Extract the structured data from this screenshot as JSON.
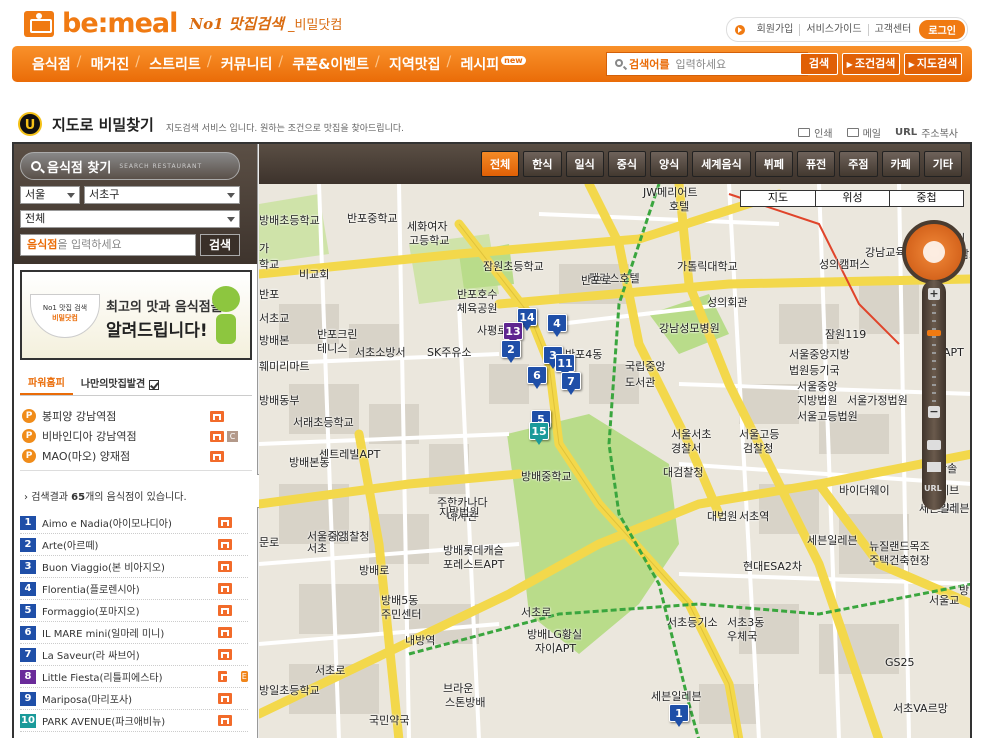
{
  "header": {
    "logo_text": "be:meal",
    "slogan": "No1 맛집검색",
    "slogan_sub": "_비밀닷컴",
    "top_links": [
      "회원가입",
      "서비스가이드",
      "고객센터"
    ],
    "login_label": "로그인"
  },
  "gnb": {
    "items": [
      "음식점",
      "매거진",
      "스트리트",
      "커뮤니티",
      "쿠폰&이벤트",
      "지역맛집",
      "레시피"
    ],
    "new_badge": "new",
    "search_keyword": "검색어를",
    "search_placeholder": "입력하세요",
    "search_button": "검색",
    "cond_button": "조건검색",
    "map_button": "지도검색"
  },
  "page": {
    "badge": "U",
    "title": "지도로 비밀찾기",
    "desc": "지도검색 서비스 입니다. 원하는 조건으로 맛집을 찾아드립니다.",
    "utils": [
      "인쇄",
      "메일",
      "주소복사"
    ],
    "url_tag": "URL"
  },
  "left_panel": {
    "finder_title": "음식점 찾기",
    "finder_en": "SEARCH RESTAURANT",
    "city": "서울",
    "district": "서초구",
    "category": "전체",
    "keyword_highlight": "음식점",
    "keyword_placeholder": "을 입력하세요",
    "search_button": "검색",
    "banner": {
      "bowl_line1": "No1 맛집 검색",
      "bowl_line2": "비밀닷컴",
      "line1": "최고의 맛과 음식점을",
      "line2": "알려드립니다!"
    },
    "tabs": [
      "파워홈피",
      "나만의맛집발견"
    ],
    "power": [
      {
        "name": "봉피양 강남역점",
        "coupon": false
      },
      {
        "name": "비바인디아 강남역점",
        "coupon": true
      },
      {
        "name": "MAO(마오) 양재점",
        "coupon": false
      }
    ],
    "power_icon": "P",
    "coupon_label": "C",
    "event_label": "E",
    "result_prefix": "검색결과 ",
    "result_count": "65",
    "result_suffix": "개의 음식점이 있습니다.",
    "results": [
      {
        "num": "1",
        "name": "Aimo e Nadia(아이모나디아)",
        "color": "blue",
        "event": false
      },
      {
        "num": "2",
        "name": "Arte(아르떼)",
        "color": "blue",
        "event": false
      },
      {
        "num": "3",
        "name": "Buon Viaggio(본 비아지오)",
        "color": "blue",
        "event": false
      },
      {
        "num": "4",
        "name": "Florentia(플로렌시아)",
        "color": "blue",
        "event": false
      },
      {
        "num": "5",
        "name": "Formaggio(포마지오)",
        "color": "blue",
        "event": false
      },
      {
        "num": "6",
        "name": "IL MARE mini(일마레 미니)",
        "color": "blue",
        "event": false
      },
      {
        "num": "7",
        "name": "La Saveur(라 싸브어)",
        "color": "blue",
        "event": false
      },
      {
        "num": "8",
        "name": "Little Fiesta(리틀피에스타)",
        "color": "purple",
        "event": true
      },
      {
        "num": "9",
        "name": "Mariposa(마리포사)",
        "color": "blue",
        "event": false
      },
      {
        "num": "10",
        "name": "PARK AVENUE(파크애비뉴)",
        "color": "teal",
        "event": false
      }
    ]
  },
  "categories": [
    "전체",
    "한식",
    "일식",
    "중식",
    "양식",
    "세계음식",
    "뷔페",
    "퓨전",
    "주점",
    "카페",
    "기타"
  ],
  "map": {
    "types": [
      "지도",
      "위성",
      "중첩"
    ],
    "zoom_plus": "+",
    "zoom_minus": "−",
    "zoom_url": "URL",
    "labels": [
      {
        "t": "JW메리어트"
      },
      {
        "t": "호텔"
      },
      {
        "t": "반포중학교"
      },
      {
        "t": "세화여자"
      },
      {
        "t": "고등학교"
      },
      {
        "t": "잠원초등학교"
      },
      {
        "t": "가톨릭대학교"
      },
      {
        "t": "성의캠퍼스"
      },
      {
        "t": "강남교육원"
      },
      {
        "t": "팰리스호텔"
      },
      {
        "t": "성의회관"
      },
      {
        "t": "강남성모병원"
      },
      {
        "t": "잠원119"
      },
      {
        "t": "반포호수"
      },
      {
        "t": "체육공원"
      },
      {
        "t": "반포크린"
      },
      {
        "t": "테니스"
      },
      {
        "t": "서초소방서"
      },
      {
        "t": "SK주유소"
      },
      {
        "t": "반포4동"
      },
      {
        "t": "국립중앙"
      },
      {
        "t": "도서관"
      },
      {
        "t": "서울중앙지방"
      },
      {
        "t": "법원등기국"
      },
      {
        "t": "서울중앙"
      },
      {
        "t": "지방법원"
      },
      {
        "t": "서울가정법원"
      },
      {
        "t": "서울고등법원"
      },
      {
        "t": "서래초등학교"
      },
      {
        "t": "서울서초"
      },
      {
        "t": "경찰서"
      },
      {
        "t": "서울고등"
      },
      {
        "t": "검찰청"
      },
      {
        "t": "대검찰청"
      },
      {
        "t": "방배본동"
      },
      {
        "t": "방배중학교"
      },
      {
        "t": "주한카나다"
      },
      {
        "t": "대사관"
      },
      {
        "t": "대법원"
      },
      {
        "t": "서초역"
      },
      {
        "t": "세븐일레븐"
      },
      {
        "t": "바이더웨이"
      },
      {
        "t": "방배롯데캐슬"
      },
      {
        "t": "포레스트APT"
      },
      {
        "t": "방배5동"
      },
      {
        "t": "주민센터"
      },
      {
        "t": "현대ESA2차"
      },
      {
        "t": "뉴질랜드목조"
      },
      {
        "t": "주택건축현장"
      },
      {
        "t": "서울교"
      },
      {
        "t": "서초등기소"
      },
      {
        "t": "서초3동"
      },
      {
        "t": "우체국"
      },
      {
        "t": "방배LG황실"
      },
      {
        "t": "자이APT"
      },
      {
        "t": "내방역"
      },
      {
        "t": "GS25"
      },
      {
        "t": "브라운"
      },
      {
        "t": "스톤방배"
      },
      {
        "t": "국민약국"
      },
      {
        "t": "서초VA르망"
      },
      {
        "t": "세븐일레븐"
      },
      {
        "t": "방일초등학교"
      },
      {
        "t": "서초로"
      },
      {
        "t": "반포로"
      },
      {
        "t": "사평로"
      },
      {
        "t": "방배로"
      },
      {
        "t": "서초로"
      },
      {
        "t": "한솔"
      },
      {
        "t": "세브"
      },
      {
        "t": "르네"
      },
      {
        "t": "APT"
      },
      {
        "t": "개비"
      },
      {
        "t": "강남교육원"
      },
      {
        "t": "가"
      },
      {
        "t": "반포"
      },
      {
        "t": "문로"
      },
      {
        "t": "방배초등학교"
      },
      {
        "t": "세븐일레븐"
      },
      {
        "t": "서초교"
      },
      {
        "t": "방배본"
      },
      {
        "t": "훼미리마트"
      },
      {
        "t": "비교회"
      },
      {
        "t": "센트레빌APT"
      },
      {
        "t": "방배동부"
      },
      {
        "t": "대검찰청"
      },
      {
        "t": "서울중앙"
      },
      {
        "t": "서초"
      },
      {
        "t": "방배"
      },
      {
        "t": "지방법원"
      },
      {
        "t": "학교"
      },
      {
        "t": "방배초등학교"
      },
      {
        "t": "훼미리마트"
      }
    ],
    "pins": [
      {
        "n": "14",
        "c": "blue"
      },
      {
        "n": "4",
        "c": "blue"
      },
      {
        "n": "13",
        "c": "purple"
      },
      {
        "n": "2",
        "c": "blue"
      },
      {
        "n": "3",
        "c": "blue"
      },
      {
        "n": "11",
        "c": "blue"
      },
      {
        "n": "6",
        "c": "blue"
      },
      {
        "n": "7",
        "c": "blue"
      },
      {
        "n": "5",
        "c": "blue"
      },
      {
        "n": "15",
        "c": "teal"
      },
      {
        "n": "1",
        "c": "blue"
      }
    ]
  }
}
